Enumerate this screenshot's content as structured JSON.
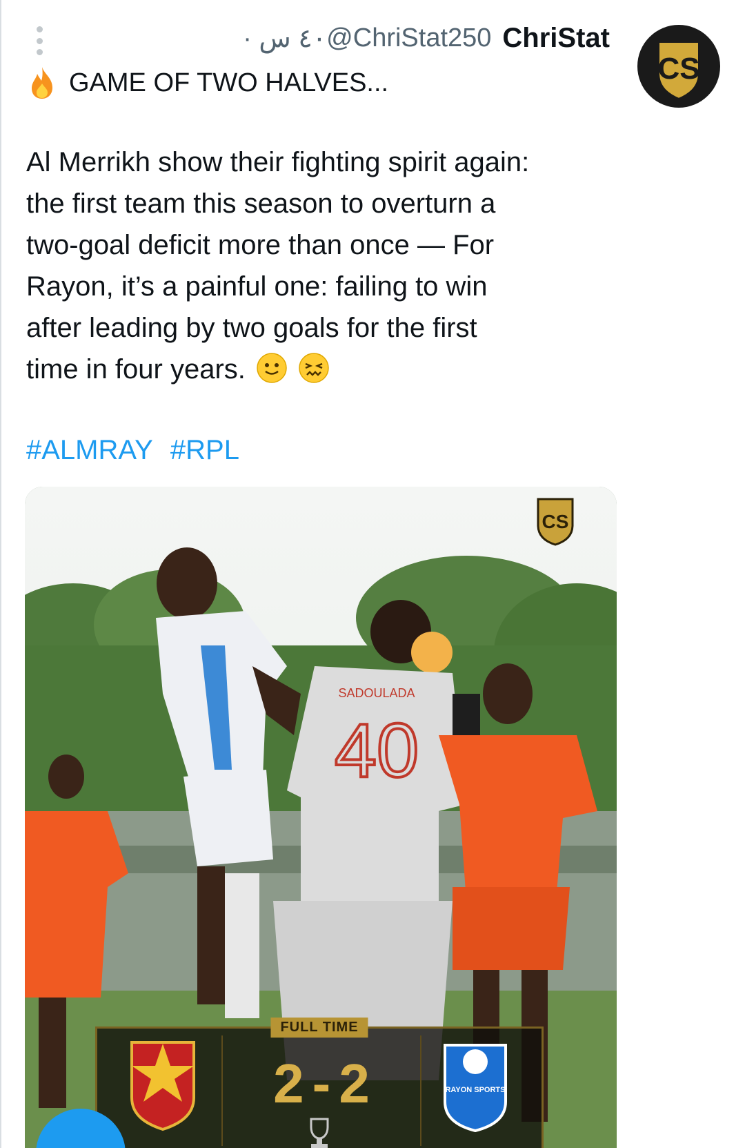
{
  "tweet": {
    "display_name": "ChriStat",
    "handle": "@ChriStat250",
    "meta": "٤٠ س · ",
    "headline": "GAME OF TWO HALVES...",
    "body_lines": [
      "Al Merrikh show their fighting spirit again:",
      "the first team this season to overturn a",
      "two-goal deficit more than once — For",
      "Rayon, it’s a painful one: failing to win",
      "after leading by two goals for the first",
      "time in four years."
    ],
    "hashtags": [
      "#ALMRAY",
      "#RPL"
    ]
  },
  "media": {
    "watermark_logo": "CS",
    "jersey_name": "SADOULADA",
    "jersey_number": "40",
    "score_label": "FULL TIME",
    "home_score": "2",
    "separator": "-",
    "away_score": "2",
    "away_badge_text": "RAYON SPORTS"
  },
  "icons": {
    "more": "vertical-dots-icon",
    "headline_emoji": "fire-icon",
    "end_emojis": [
      "slightly-smiling-face-icon",
      "tired-face-icon"
    ],
    "avatar_logo": "CS"
  },
  "colors": {
    "hashtag": "#1d9bf0",
    "meta_text": "#536471",
    "score_gold": "#d8b04a",
    "home_kit": "#f05a22",
    "away_kit": "#e7e9ee"
  }
}
